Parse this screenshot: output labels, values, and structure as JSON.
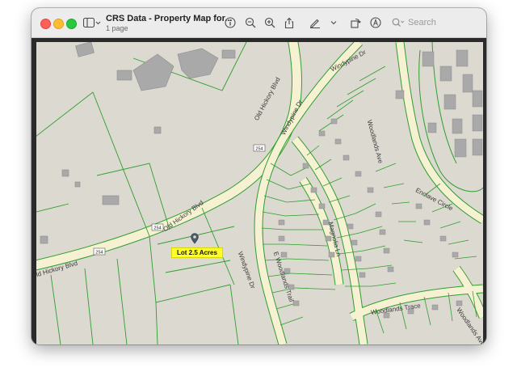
{
  "window": {
    "title": "CRS Data - Property Map for...",
    "subtitle": "1 page"
  },
  "toolbar": {
    "sidebar_icon": "sidebar-icon",
    "search_placeholder": "Search"
  },
  "map": {
    "streets": {
      "old_hickory_1": "Old Hickory Blvd",
      "old_hickory_2": "Old Hickory Blvd",
      "old_hickory_3": "Old Hickory Blvd",
      "windypine_top": "Windypine Dr",
      "windypine_mid": "Windypine Dr",
      "windypine_low": "Windypine Dr",
      "woodlands_ave_top": "Woodlands Ave",
      "woodlands_ave_bottom": "Woodlands Ave",
      "enclave": "Enclave Circle",
      "e_woodlands": "E Woodlands Trail",
      "magnolia": "Magnolia Ln",
      "woodlands_trace": "Woodlands Trace"
    },
    "route_shields": [
      "254",
      "254",
      "254"
    ],
    "lot_label": "Lot 2.5 Acres",
    "colors": {
      "parcel_line": "#2f9e2f",
      "road_fill": "#f6f1d2",
      "background": "#dcd9d0",
      "building": "#a9a9a9",
      "highlight": "#ffff2a"
    }
  }
}
